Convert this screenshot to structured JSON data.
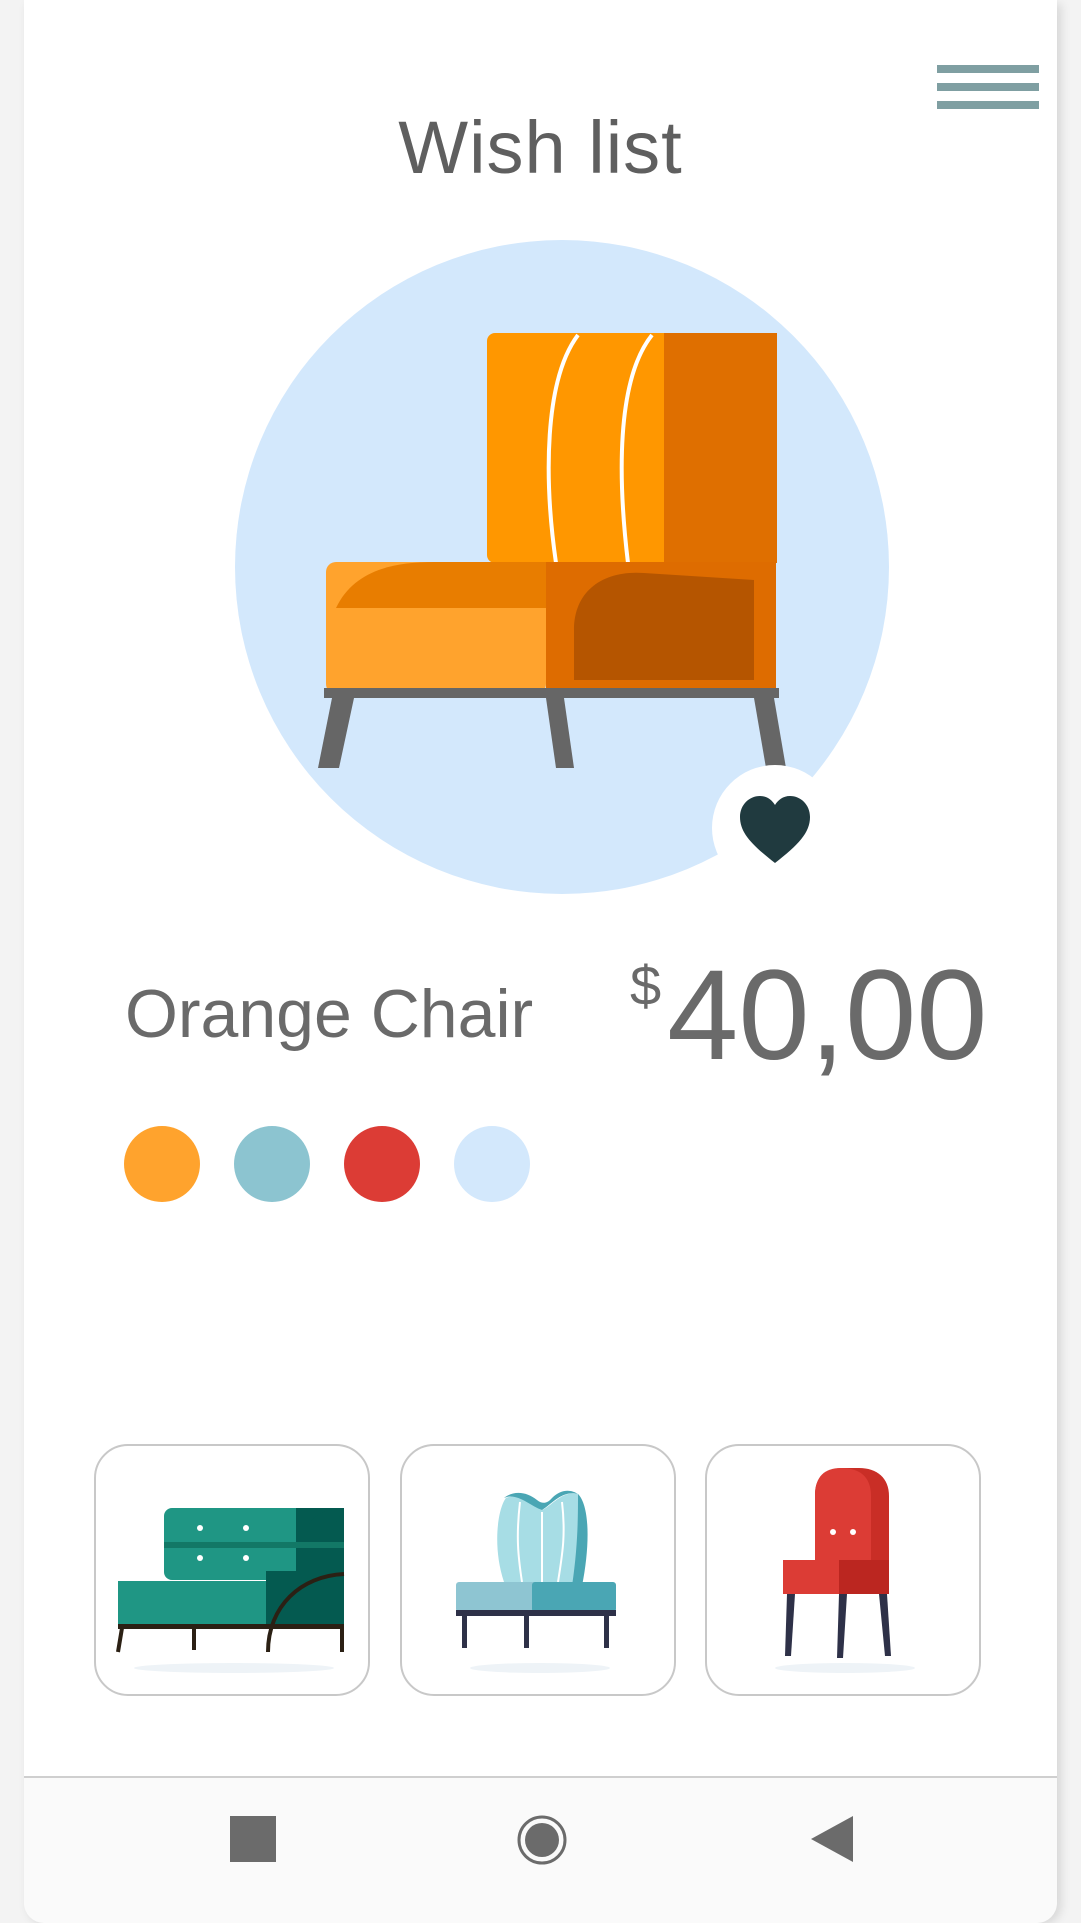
{
  "header": {
    "title": "Wish list",
    "menu_icon": "hamburger-menu-icon"
  },
  "product": {
    "name": "Orange Chair",
    "currency": "$",
    "price": "40,00",
    "favorite": true,
    "favorite_icon": "heart-icon",
    "colors": [
      "#ffa32d",
      "#8cc4d0",
      "#dc3c35",
      "#d3e8fc"
    ]
  },
  "related_products": [
    {
      "icon": "green-sofa-icon"
    },
    {
      "icon": "blue-armchair-icon"
    },
    {
      "icon": "red-chair-icon"
    }
  ],
  "navigation": {
    "recent_icon": "square-icon",
    "home_icon": "circle-icon",
    "back_icon": "triangle-back-icon"
  },
  "colors": {
    "text": "#6a6a6a",
    "hero_circle": "#d3e8fc",
    "menu": "#7f9fa2",
    "heart": "#203a3f"
  }
}
